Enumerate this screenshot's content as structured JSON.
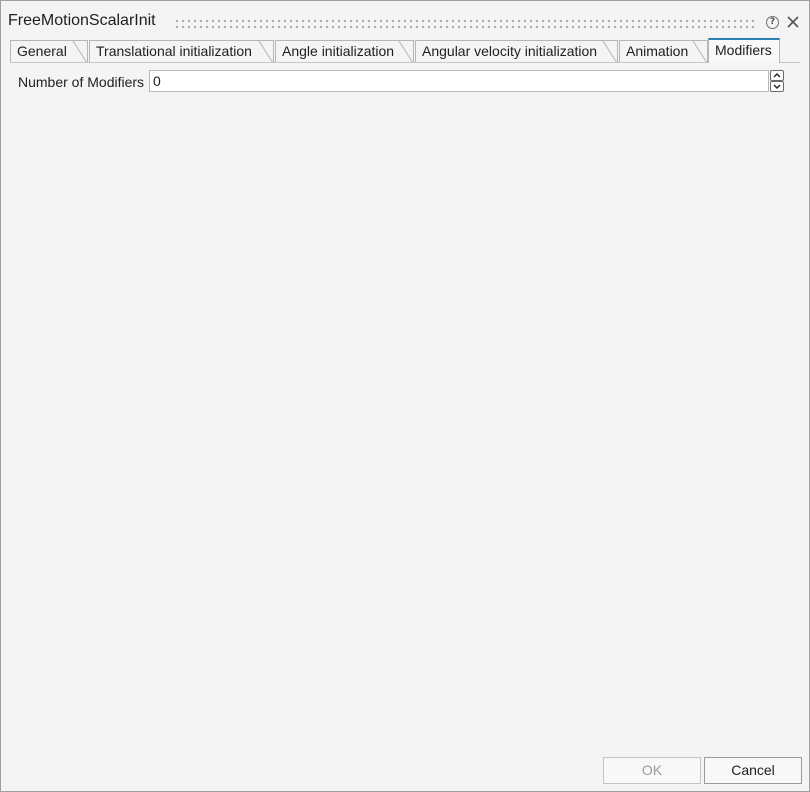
{
  "window": {
    "title": "FreeMotionScalarInit"
  },
  "tabs": [
    {
      "label": "General",
      "active": false
    },
    {
      "label": "Translational initialization",
      "active": false
    },
    {
      "label": "Angle initialization",
      "active": false
    },
    {
      "label": "Angular velocity initialization",
      "active": false
    },
    {
      "label": "Animation",
      "active": false
    },
    {
      "label": "Modifiers",
      "active": true
    }
  ],
  "modifiers": {
    "count_label": "Number of Modifiers",
    "count_value": "0"
  },
  "footer": {
    "ok_label": "OK",
    "cancel_label": "Cancel",
    "ok_enabled": false
  },
  "colors": {
    "active_tab_accent": "#2a7fb0",
    "background": "#f4f4f4"
  }
}
